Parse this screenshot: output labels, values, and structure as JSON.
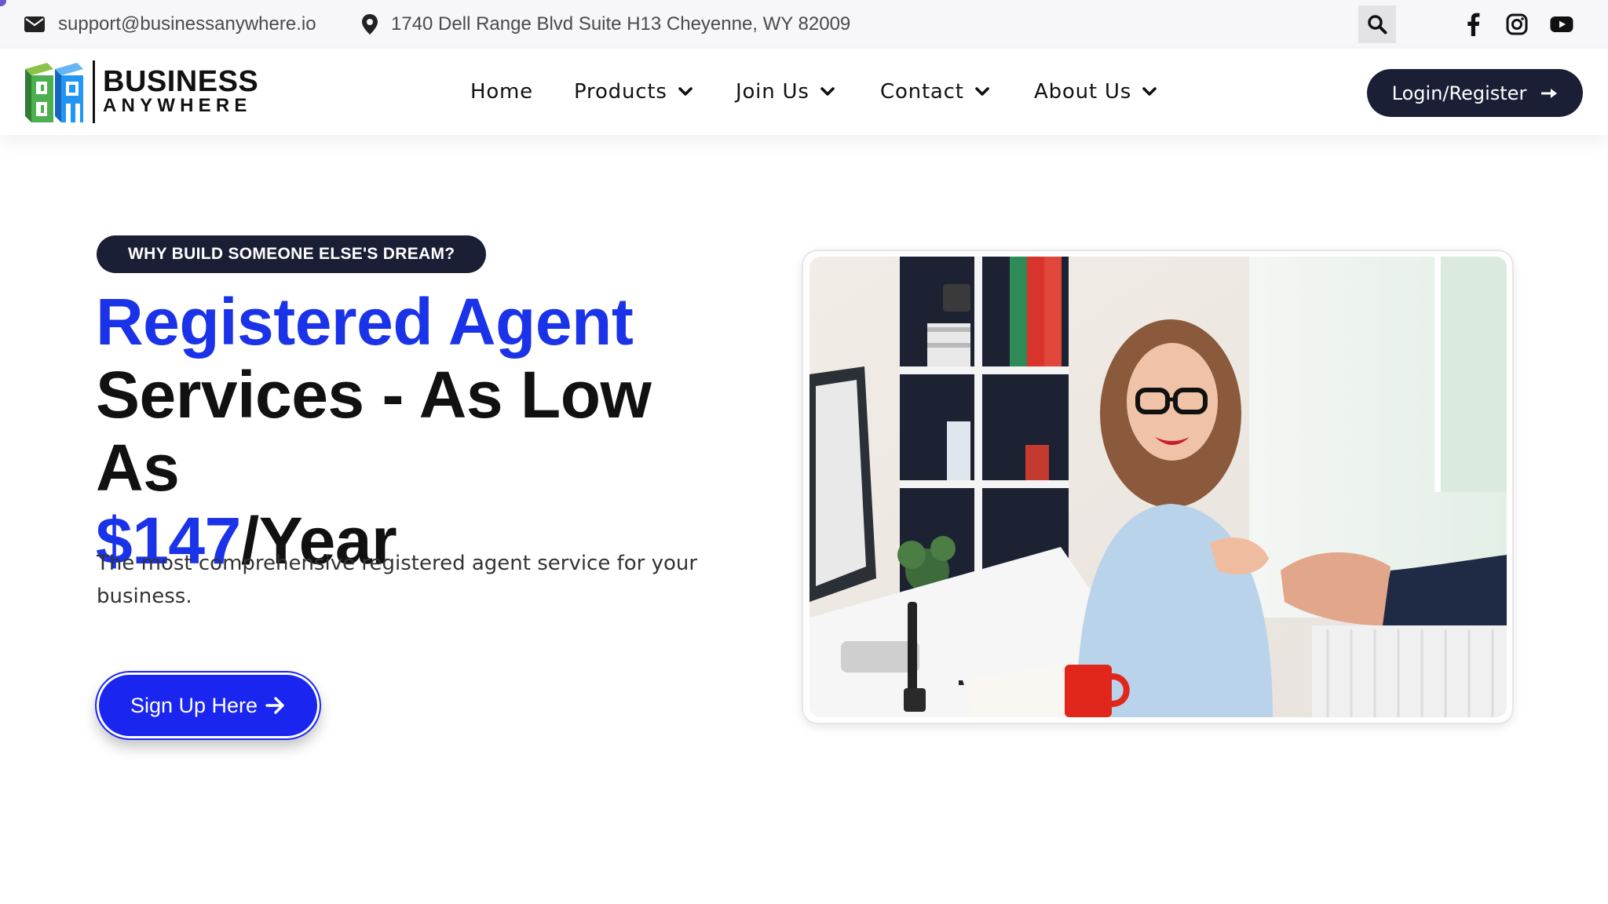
{
  "topbar": {
    "email": "support@businessanywhere.io",
    "address": "1740 Dell Range Blvd Suite H13 Cheyenne, WY 82009",
    "icons": {
      "email": "envelope-icon",
      "address": "map-pin-icon",
      "search": "search-icon",
      "facebook": "facebook-icon",
      "instagram": "instagram-icon",
      "youtube": "youtube-icon"
    }
  },
  "header": {
    "logo": {
      "line1": "BUSINESS",
      "line2": "ANYWHERE"
    },
    "nav": [
      {
        "label": "Home",
        "dropdown": false
      },
      {
        "label": "Products",
        "dropdown": true
      },
      {
        "label": "Join Us",
        "dropdown": true
      },
      {
        "label": "Contact",
        "dropdown": true
      },
      {
        "label": "About Us",
        "dropdown": true
      }
    ],
    "login_label": "Login/Register"
  },
  "hero": {
    "tagline": "WHY BUILD SOMEONE ELSE'S DREAM?",
    "headline": {
      "accent": "Registered Agent",
      "middle": "Services - As Low As",
      "price": "$147",
      "suffix": "/Year"
    },
    "description": "The most comprehensive registered agent service for your business.",
    "cta_label": "Sign Up Here"
  },
  "colors": {
    "accent_blue": "#1a33e8",
    "navy": "#1a1f36",
    "cta_blue": "#1a26f0"
  }
}
